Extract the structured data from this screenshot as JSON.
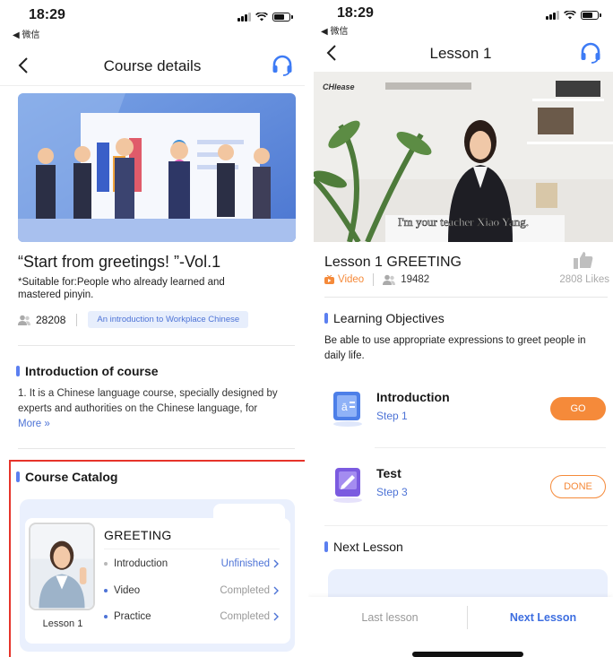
{
  "left": {
    "status": {
      "time": "18:29",
      "back_app": "◀ 微信"
    },
    "nav": {
      "title": "Course details"
    },
    "course": {
      "title": "“Start from greetings! ”-Vol.1",
      "subtitle": "*Suitable for:People who already learned and mastered pinyin.",
      "learners": "28208",
      "tag": "An introduction to Workplace Chinese"
    },
    "intro": {
      "heading": "Introduction of course",
      "text": "1. It is a Chinese language course, specially designed by experts and authorities on the Chinese language, for",
      "more": "More »"
    },
    "catalog": {
      "heading": "Course Catalog",
      "lesson_title": "GREETING",
      "lesson_label": "Lesson 1",
      "rows": [
        {
          "name": "Introduction",
          "state": "Unfinished",
          "state_color": "#4d73d6",
          "dot_color": "#b8b8b8"
        },
        {
          "name": "Video",
          "state": "Completed",
          "state_color": "#999999",
          "dot_color": "#4d73d6"
        },
        {
          "name": "Practice",
          "state": "Completed",
          "state_color": "#999999",
          "dot_color": "#4d73d6"
        }
      ]
    }
  },
  "right": {
    "status": {
      "time": "18:29",
      "back_app": "◀ 微信"
    },
    "nav": {
      "title": "Lesson 1"
    },
    "video": {
      "logo": "CHIease",
      "caption": "I'm your teacher Xiao Yang."
    },
    "lesson": {
      "title": "Lesson 1 GREETING",
      "type": "Video",
      "views": "19482",
      "likes": "2808 Likes"
    },
    "objectives": {
      "heading": "Learning Objectives",
      "text": "Be able to use appropriate expressions to greet people in daily life."
    },
    "steps": [
      {
        "title": "Introduction",
        "sub": "Step 1",
        "button": "GO"
      },
      {
        "title": "Test",
        "sub": "Step 3",
        "button": "DONE"
      }
    ],
    "next": {
      "heading": "Next Lesson"
    },
    "bottom": {
      "last": "Last lesson",
      "next": "Next Lesson"
    }
  },
  "colors": {
    "accent": "#4d73d6",
    "orange": "#f58a3a",
    "highlight": "#e6332a"
  }
}
